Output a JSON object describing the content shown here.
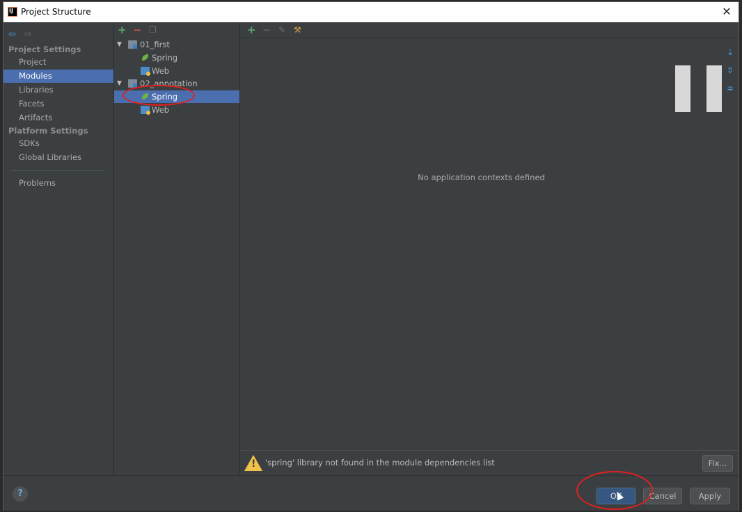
{
  "window": {
    "title": "Project Structure",
    "close_glyph": "✕"
  },
  "left_panel": {
    "project_settings_title": "Project Settings",
    "project_items": [
      "Project",
      "Modules",
      "Libraries",
      "Facets",
      "Artifacts"
    ],
    "platform_settings_title": "Platform Settings",
    "platform_items": [
      "SDKs",
      "Global Libraries"
    ],
    "problems_label": "Problems",
    "selected": "Modules"
  },
  "tree": {
    "rows": [
      {
        "label": "01_first",
        "type": "module",
        "expanded": true
      },
      {
        "label": "Spring",
        "type": "spring"
      },
      {
        "label": "Web",
        "type": "web"
      },
      {
        "label": "02_annotation",
        "type": "module",
        "expanded": true
      },
      {
        "label": "Spring",
        "type": "spring",
        "selected": true
      },
      {
        "label": "Web",
        "type": "web"
      }
    ]
  },
  "content": {
    "empty_message": "No application contexts defined",
    "warning_text": "'spring' library not found in the module dependencies list",
    "fix_label": "Fix..."
  },
  "footer": {
    "help_label": "?",
    "ok_label": "OK",
    "cancel_label": "Cancel",
    "apply_label": "Apply"
  },
  "colors": {
    "selection": "#4b6eaf",
    "background": "#3c3f41",
    "annotation": "#e02020"
  }
}
